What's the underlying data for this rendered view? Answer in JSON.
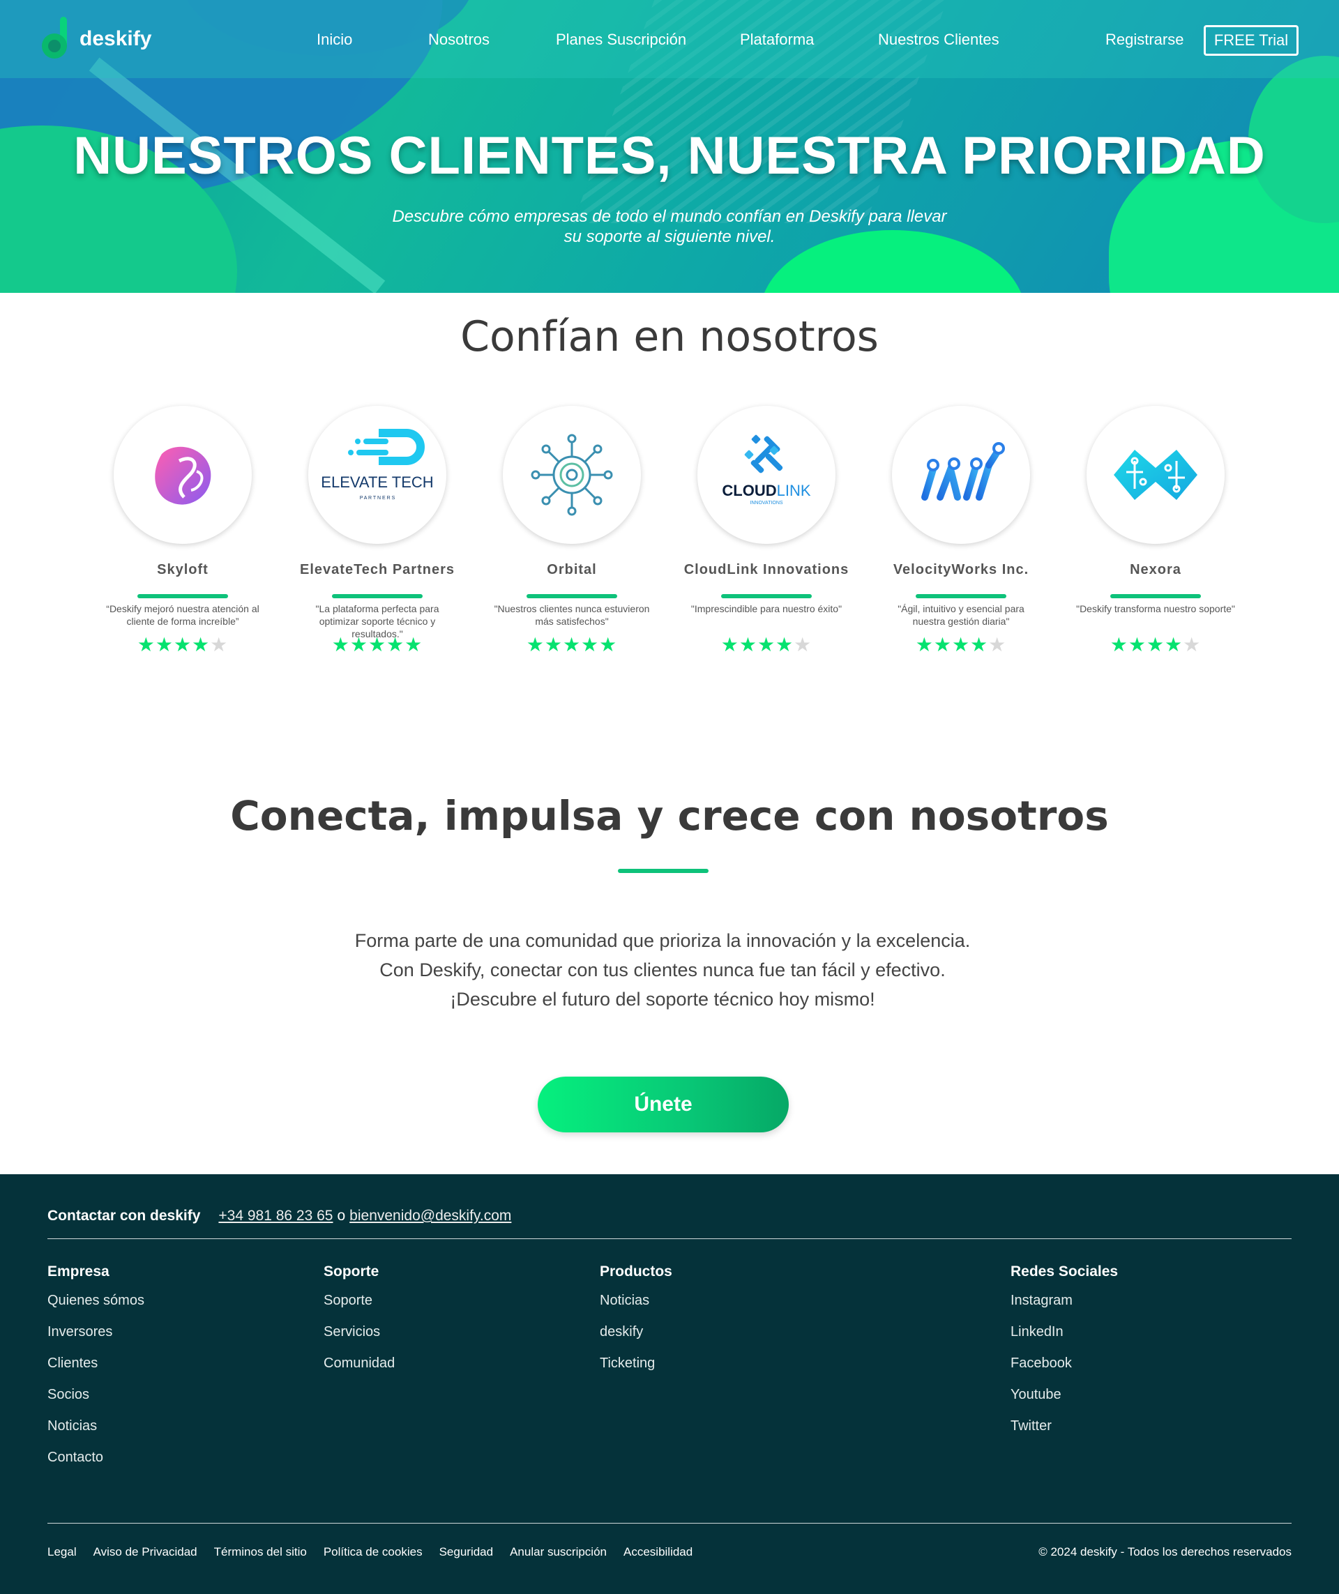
{
  "nav": {
    "logo_text": "deskify",
    "links": [
      "Inicio",
      "Nosotros",
      "Planes Suscripción",
      "Plataforma",
      "Nuestros Clientes"
    ],
    "register": "Registrarse",
    "trial": "FREE Trial"
  },
  "hero": {
    "title": "NUESTROS CLIENTES, NUESTRA PRIORIDAD",
    "subtitle_line1": "Descubre cómo empresas de todo el mundo confían en Deskify para llevar",
    "subtitle_line2": "su soporte al siguiente nivel."
  },
  "trust": {
    "title": "Confían en nosotros",
    "clients": [
      {
        "name": "Skyloft",
        "quote": "“Deskify mejoró nuestra atención al cliente de forma increíble”",
        "rating": 4,
        "logo": "skyloft-logo"
      },
      {
        "name": "ElevateTech Partners",
        "quote": "\"La plataforma perfecta para optimizar soporte técnico y resultados.\"",
        "rating": 5,
        "logo": "elevatetech-logo",
        "logo_text": "ELEVATE TECH",
        "logo_subtext": "P A R T N E R S"
      },
      {
        "name": "Orbital",
        "quote": "\"Nuestros clientes nunca estuvieron más satisfechos\"",
        "rating": 5,
        "logo": "orbital-logo"
      },
      {
        "name": "CloudLink Innovations",
        "quote": "\"Imprescindible para nuestro éxito\"",
        "rating": 4,
        "logo": "cloudlink-logo",
        "logo_text_a": "CLOUD",
        "logo_text_b": "LINK",
        "logo_subtext": "INNOVATIONS"
      },
      {
        "name": "VelocityWorks Inc.",
        "quote": "\"Ágil, intuitivo y esencial para nuestra gestión diaria\"",
        "rating": 4,
        "logo": "velocityworks-logo"
      },
      {
        "name": "Nexora",
        "quote": "\"Deskify transforma nuestro soporte\"",
        "rating": 4,
        "logo": "nexora-logo"
      }
    ]
  },
  "cta": {
    "title": "Conecta, impulsa y crece con nosotros",
    "line1": "Forma parte de una comunidad que prioriza la innovación y la excelencia.",
    "line2": "Con Deskify, conectar con tus clientes nunca fue tan fácil y efectivo.",
    "line3": "¡Descubre el futuro del soporte técnico hoy mismo!",
    "button": "Únete"
  },
  "footer": {
    "contact_label": "Contactar con deskify",
    "phone": "+34 981 86 23 65",
    "or": "o",
    "email": "bienvenido@deskify.com",
    "columns": [
      {
        "title": "Empresa",
        "links": [
          "Quienes sómos",
          "Inversores",
          "Clientes",
          "Socios",
          "Noticias",
          "Contacto"
        ]
      },
      {
        "title": "Soporte",
        "links": [
          "Soporte",
          "Servicios",
          "Comunidad"
        ]
      },
      {
        "title": "Productos",
        "links": [
          "Noticias",
          "deskify",
          "Ticketing"
        ]
      },
      {
        "title": "Redes Sociales",
        "links": [
          "Instagram",
          "LinkedIn",
          "Facebook",
          "Youtube",
          "Twitter"
        ]
      }
    ],
    "legal": [
      "Legal",
      "Aviso de Privacidad",
      "Términos del sitio",
      "Política de cookies",
      "Seguridad",
      "Anular suscripción",
      "Accesibilidad"
    ],
    "copyright": "© 2024 deskify - Todos los derechos reservados"
  },
  "colors": {
    "accent": "#07e26f",
    "footer_bg": "#05323a",
    "star_off": "#d8d8d8"
  }
}
